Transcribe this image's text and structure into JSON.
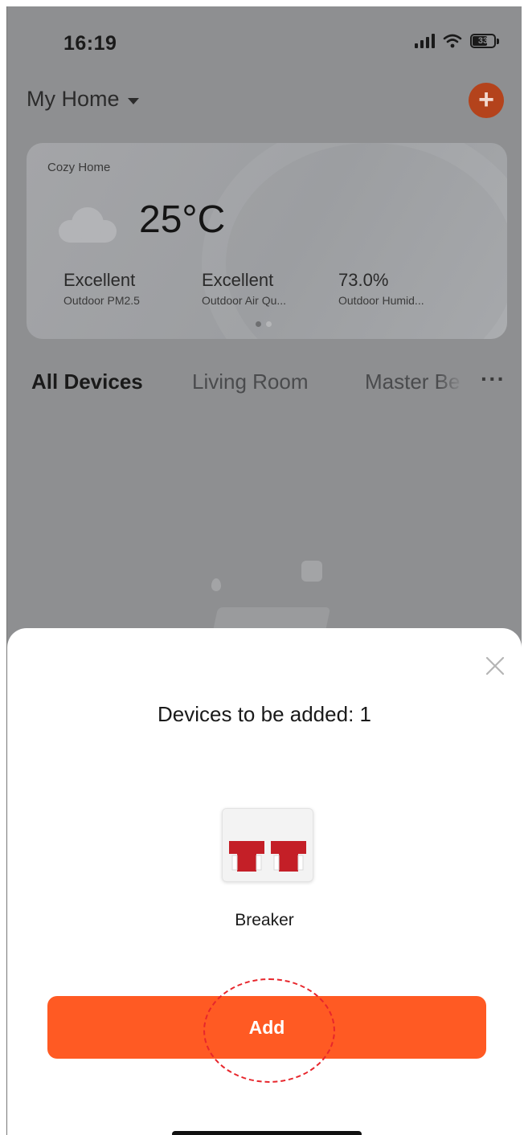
{
  "status_bar": {
    "time": "16:19",
    "battery": "33"
  },
  "header": {
    "home_name": "My Home"
  },
  "weather_card": {
    "name": "Cozy Home",
    "temperature": "25°C",
    "metrics": [
      {
        "value": "Excellent",
        "label": "Outdoor PM2.5"
      },
      {
        "value": "Excellent",
        "label": "Outdoor Air Qu..."
      },
      {
        "value": "73.0%",
        "label": "Outdoor Humid..."
      }
    ],
    "pager_active": 1,
    "pager_count": 2
  },
  "tabs": [
    {
      "label": "All Devices",
      "active": true
    },
    {
      "label": "Living Room",
      "active": false
    },
    {
      "label": "Master Be",
      "active": false
    }
  ],
  "tabs_more": "···",
  "sheet": {
    "title": "Devices to be added: 1",
    "device_name": "Breaker",
    "add_label": "Add"
  },
  "colors": {
    "accent": "#ff5a23",
    "annotation": "#e7262c",
    "breaker_red": "#c41f27"
  }
}
